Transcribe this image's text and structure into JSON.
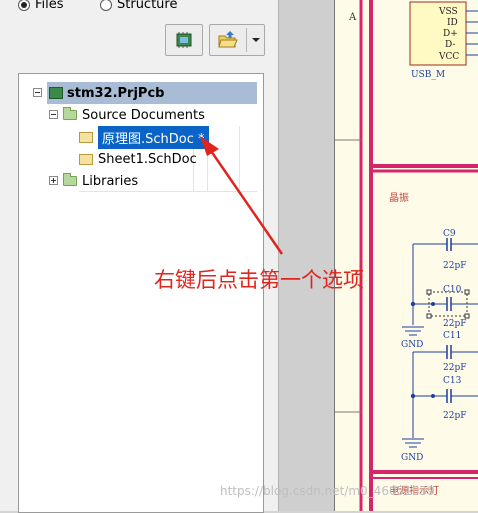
{
  "view_options": {
    "files_label": "Files",
    "structure_label": "Structure",
    "selected": "Files"
  },
  "toolbar": {
    "compile_icon": "compile-chip-icon",
    "open_icon": "open-folder-icon",
    "dropdown_icon": "chevron-down-icon"
  },
  "tree": {
    "project": "stm32.PrjPcb",
    "source_folder": "Source Documents",
    "documents": [
      {
        "label": "原理图.SchDoc *",
        "selected": true
      },
      {
        "label": "Sheet1.SchDoc",
        "selected": false
      }
    ],
    "libraries": "Libraries"
  },
  "schematic": {
    "border_row_label": "A",
    "usb_pins": [
      "VSS",
      "ID",
      "D+",
      "D-",
      "VCC"
    ],
    "usb_ref": "USB_M",
    "crystal_section": "晶振",
    "caps": [
      {
        "ref": "C9",
        "value": "22pF"
      },
      {
        "ref": "C10",
        "value": "22pF"
      },
      {
        "ref": "C11",
        "value": "22pF"
      },
      {
        "ref": "C13",
        "value": "22pF"
      }
    ],
    "gnd_label": "GND",
    "power_section": "电源指示灯",
    "accent_color": "#d6266b"
  },
  "annotation": {
    "text": "右键后点击第一个选项",
    "color": "#e0241e"
  },
  "watermark": "https://blog.csdn.net/m0_46051039"
}
